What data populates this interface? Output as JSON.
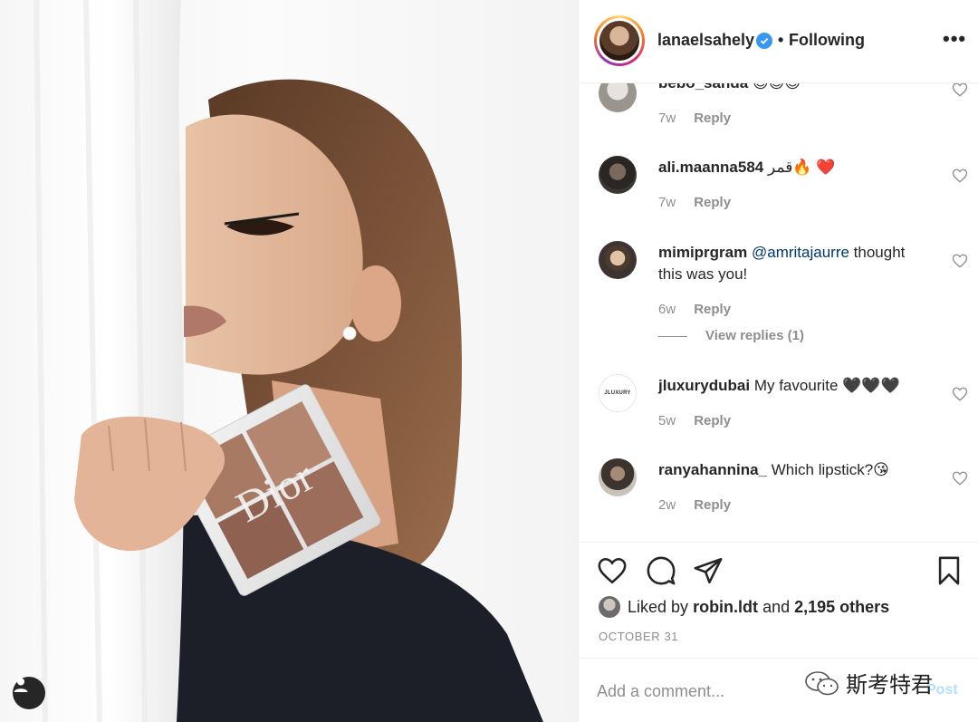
{
  "header": {
    "username": "lanaelsahely",
    "separator": "•",
    "follow_status": "Following",
    "more_label": "•••"
  },
  "comments": [
    {
      "username": "bebo_sanda",
      "text": "😊😊😊",
      "age": "7w",
      "reply": "Reply"
    },
    {
      "username": "ali.maanna584",
      "text": "قمر🔥 ❤️",
      "age": "7w",
      "reply": "Reply"
    },
    {
      "username": "mimiprgram",
      "mention": "@amritajaurre",
      "text": " thought this was you!",
      "age": "6w",
      "reply": "Reply",
      "view_replies": "View replies (1)"
    },
    {
      "username": "jluxurydubai",
      "text": "My favourite 🖤🖤🖤",
      "age": "5w",
      "reply": "Reply",
      "avatar_text": "JLUXURY"
    },
    {
      "username": "ranyahannina_",
      "text": "Which lipstick?😘",
      "age": "2w",
      "reply": "Reply"
    }
  ],
  "likes": {
    "prefix": "Liked by ",
    "user": "robin.ldt",
    "middle": " and ",
    "others": "2,195 others"
  },
  "post_date": "OCTOBER 31",
  "add_comment": {
    "placeholder": "Add a comment...",
    "post_label": "Post"
  },
  "photo": {
    "palette_brand": "Dior"
  },
  "watermark": "斯考特君",
  "colors": {
    "verified": "#3897f0",
    "secondary_text": "#8e8e8e",
    "link": "#00376b",
    "post_disabled": "#b2dffc"
  }
}
